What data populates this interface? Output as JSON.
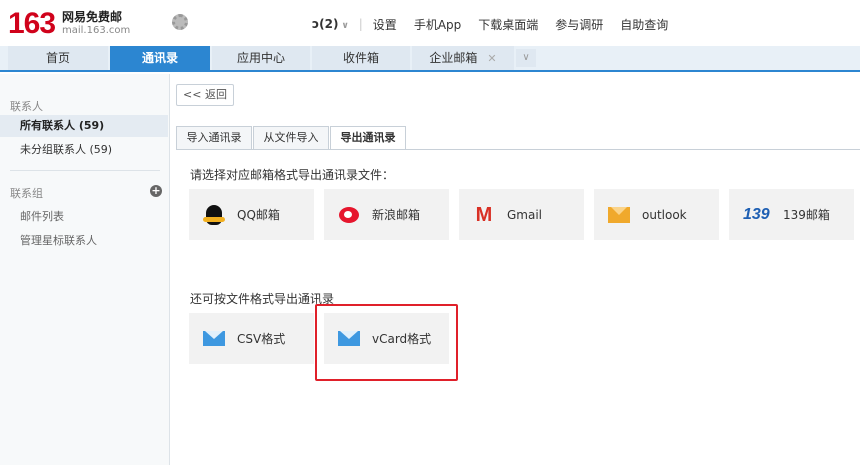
{
  "brand": {
    "logo_number": "163",
    "logo_cn": "网易免费邮",
    "logo_domain": "mail.163.com"
  },
  "topbar": {
    "unread_badge": "ɔ(2)",
    "links": [
      "设置",
      "手机App",
      "下载桌面端",
      "参与调研",
      "自助查询"
    ]
  },
  "tabs": [
    {
      "label": "首页",
      "active": false
    },
    {
      "label": "通讯录",
      "active": true
    },
    {
      "label": "应用中心",
      "active": false
    },
    {
      "label": "收件箱",
      "active": false
    },
    {
      "label": "企业邮箱",
      "active": false
    }
  ],
  "sidebar": {
    "contacts_label": "联系人",
    "items": [
      "所有联系人 (59)",
      "未分组联系人 (59)"
    ],
    "groups_label": "联系组",
    "group_items": [
      "邮件列表",
      "管理星标联系人"
    ]
  },
  "main": {
    "back_label": "<< 返回",
    "subtabs": [
      "导入通讯录",
      "从文件导入",
      "导出通讯录"
    ],
    "prompt": "请选择对应邮箱格式导出通讯录文件：",
    "providers": [
      "QQ邮箱",
      "新浪邮箱",
      "Gmail",
      "outlook",
      "139邮箱"
    ],
    "alt_prompt": "还可按文件格式导出通讯录",
    "formats": [
      "CSV格式",
      "vCard格式"
    ],
    "icon_139": "139"
  },
  "colors": {
    "brand_red": "#d0021b",
    "accent_blue": "#2c86d1",
    "highlight_red": "#e0202a"
  }
}
